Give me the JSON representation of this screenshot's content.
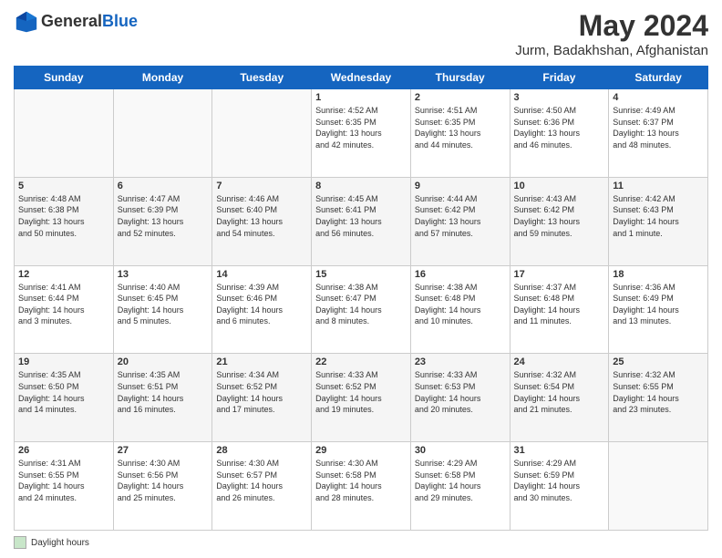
{
  "header": {
    "logo_line1": "General",
    "logo_line2": "Blue",
    "month_title": "May 2024",
    "subtitle": "Jurm, Badakhshan, Afghanistan"
  },
  "days_of_week": [
    "Sunday",
    "Monday",
    "Tuesday",
    "Wednesday",
    "Thursday",
    "Friday",
    "Saturday"
  ],
  "weeks": [
    [
      {
        "day": "",
        "info": ""
      },
      {
        "day": "",
        "info": ""
      },
      {
        "day": "",
        "info": ""
      },
      {
        "day": "1",
        "info": "Sunrise: 4:52 AM\nSunset: 6:35 PM\nDaylight: 13 hours\nand 42 minutes."
      },
      {
        "day": "2",
        "info": "Sunrise: 4:51 AM\nSunset: 6:35 PM\nDaylight: 13 hours\nand 44 minutes."
      },
      {
        "day": "3",
        "info": "Sunrise: 4:50 AM\nSunset: 6:36 PM\nDaylight: 13 hours\nand 46 minutes."
      },
      {
        "day": "4",
        "info": "Sunrise: 4:49 AM\nSunset: 6:37 PM\nDaylight: 13 hours\nand 48 minutes."
      }
    ],
    [
      {
        "day": "5",
        "info": "Sunrise: 4:48 AM\nSunset: 6:38 PM\nDaylight: 13 hours\nand 50 minutes."
      },
      {
        "day": "6",
        "info": "Sunrise: 4:47 AM\nSunset: 6:39 PM\nDaylight: 13 hours\nand 52 minutes."
      },
      {
        "day": "7",
        "info": "Sunrise: 4:46 AM\nSunset: 6:40 PM\nDaylight: 13 hours\nand 54 minutes."
      },
      {
        "day": "8",
        "info": "Sunrise: 4:45 AM\nSunset: 6:41 PM\nDaylight: 13 hours\nand 56 minutes."
      },
      {
        "day": "9",
        "info": "Sunrise: 4:44 AM\nSunset: 6:42 PM\nDaylight: 13 hours\nand 57 minutes."
      },
      {
        "day": "10",
        "info": "Sunrise: 4:43 AM\nSunset: 6:42 PM\nDaylight: 13 hours\nand 59 minutes."
      },
      {
        "day": "11",
        "info": "Sunrise: 4:42 AM\nSunset: 6:43 PM\nDaylight: 14 hours\nand 1 minute."
      }
    ],
    [
      {
        "day": "12",
        "info": "Sunrise: 4:41 AM\nSunset: 6:44 PM\nDaylight: 14 hours\nand 3 minutes."
      },
      {
        "day": "13",
        "info": "Sunrise: 4:40 AM\nSunset: 6:45 PM\nDaylight: 14 hours\nand 5 minutes."
      },
      {
        "day": "14",
        "info": "Sunrise: 4:39 AM\nSunset: 6:46 PM\nDaylight: 14 hours\nand 6 minutes."
      },
      {
        "day": "15",
        "info": "Sunrise: 4:38 AM\nSunset: 6:47 PM\nDaylight: 14 hours\nand 8 minutes."
      },
      {
        "day": "16",
        "info": "Sunrise: 4:38 AM\nSunset: 6:48 PM\nDaylight: 14 hours\nand 10 minutes."
      },
      {
        "day": "17",
        "info": "Sunrise: 4:37 AM\nSunset: 6:48 PM\nDaylight: 14 hours\nand 11 minutes."
      },
      {
        "day": "18",
        "info": "Sunrise: 4:36 AM\nSunset: 6:49 PM\nDaylight: 14 hours\nand 13 minutes."
      }
    ],
    [
      {
        "day": "19",
        "info": "Sunrise: 4:35 AM\nSunset: 6:50 PM\nDaylight: 14 hours\nand 14 minutes."
      },
      {
        "day": "20",
        "info": "Sunrise: 4:35 AM\nSunset: 6:51 PM\nDaylight: 14 hours\nand 16 minutes."
      },
      {
        "day": "21",
        "info": "Sunrise: 4:34 AM\nSunset: 6:52 PM\nDaylight: 14 hours\nand 17 minutes."
      },
      {
        "day": "22",
        "info": "Sunrise: 4:33 AM\nSunset: 6:52 PM\nDaylight: 14 hours\nand 19 minutes."
      },
      {
        "day": "23",
        "info": "Sunrise: 4:33 AM\nSunset: 6:53 PM\nDaylight: 14 hours\nand 20 minutes."
      },
      {
        "day": "24",
        "info": "Sunrise: 4:32 AM\nSunset: 6:54 PM\nDaylight: 14 hours\nand 21 minutes."
      },
      {
        "day": "25",
        "info": "Sunrise: 4:32 AM\nSunset: 6:55 PM\nDaylight: 14 hours\nand 23 minutes."
      }
    ],
    [
      {
        "day": "26",
        "info": "Sunrise: 4:31 AM\nSunset: 6:55 PM\nDaylight: 14 hours\nand 24 minutes."
      },
      {
        "day": "27",
        "info": "Sunrise: 4:30 AM\nSunset: 6:56 PM\nDaylight: 14 hours\nand 25 minutes."
      },
      {
        "day": "28",
        "info": "Sunrise: 4:30 AM\nSunset: 6:57 PM\nDaylight: 14 hours\nand 26 minutes."
      },
      {
        "day": "29",
        "info": "Sunrise: 4:30 AM\nSunset: 6:58 PM\nDaylight: 14 hours\nand 28 minutes."
      },
      {
        "day": "30",
        "info": "Sunrise: 4:29 AM\nSunset: 6:58 PM\nDaylight: 14 hours\nand 29 minutes."
      },
      {
        "day": "31",
        "info": "Sunrise: 4:29 AM\nSunset: 6:59 PM\nDaylight: 14 hours\nand 30 minutes."
      },
      {
        "day": "",
        "info": ""
      }
    ]
  ],
  "footer": {
    "legend_label": "Daylight hours"
  }
}
